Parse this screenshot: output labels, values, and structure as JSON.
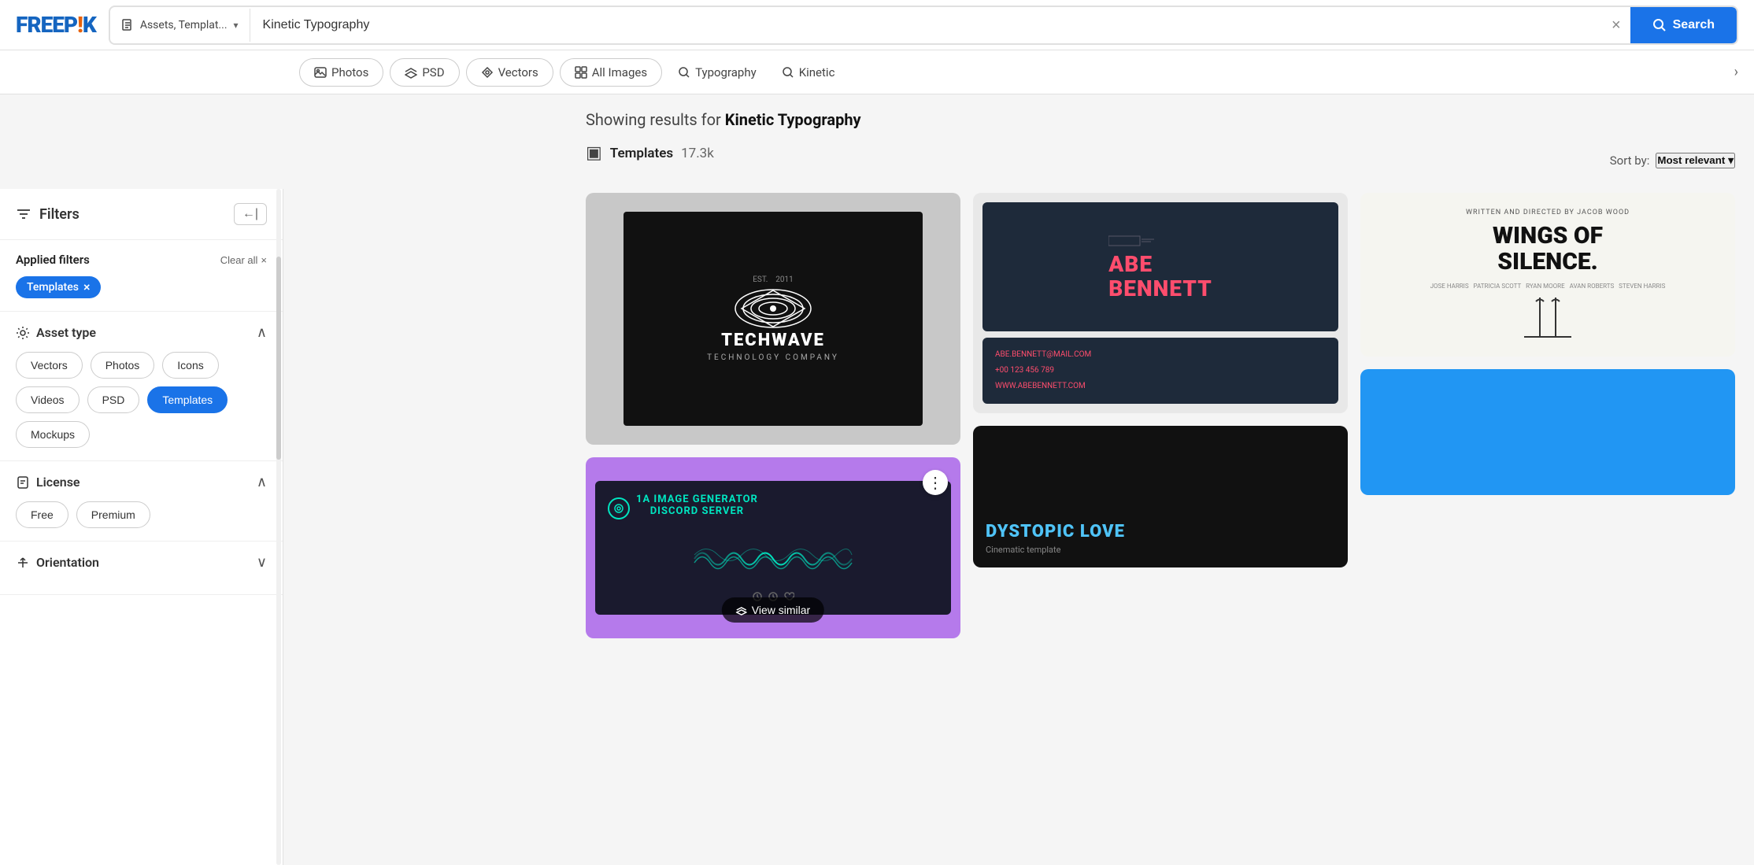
{
  "logo": {
    "text": "FREEPIK",
    "free": "FREEP!K"
  },
  "header": {
    "search_type_label": "Assets, Templat...",
    "search_value": "Kinetic Typography",
    "search_button_label": "Search",
    "clear_title": "Clear search"
  },
  "sub_nav": {
    "items": [
      {
        "id": "photos",
        "label": "Photos",
        "icon": "image"
      },
      {
        "id": "psd",
        "label": "PSD",
        "icon": "layers"
      },
      {
        "id": "vectors",
        "label": "Vectors",
        "icon": "pen-tool"
      },
      {
        "id": "all-images",
        "label": "All Images",
        "icon": "grid"
      },
      {
        "id": "typography",
        "label": "Typography",
        "icon": "search"
      },
      {
        "id": "kinetic",
        "label": "Kinetic",
        "icon": "search"
      }
    ],
    "chevron_right": "›"
  },
  "sidebar": {
    "title": "Filters",
    "collapse_icon": "←|",
    "applied_filters": {
      "label": "Applied filters",
      "clear_label": "Clear all",
      "clear_icon": "×",
      "tags": [
        {
          "id": "templates",
          "label": "Templates",
          "removable": true
        }
      ]
    },
    "sections": [
      {
        "id": "asset-type",
        "title": "Asset type",
        "icon": "⚙",
        "expanded": true,
        "items": [
          {
            "id": "vectors",
            "label": "Vectors",
            "active": false
          },
          {
            "id": "photos",
            "label": "Photos",
            "active": false
          },
          {
            "id": "icons",
            "label": "Icons",
            "active": false
          },
          {
            "id": "videos",
            "label": "Videos",
            "active": false
          },
          {
            "id": "psd",
            "label": "PSD",
            "active": false
          },
          {
            "id": "templates",
            "label": "Templates",
            "active": true
          },
          {
            "id": "mockups",
            "label": "Mockups",
            "active": false
          }
        ]
      },
      {
        "id": "license",
        "title": "License",
        "icon": "🏷",
        "expanded": true,
        "items": [
          {
            "id": "free",
            "label": "Free",
            "active": false
          },
          {
            "id": "premium",
            "label": "Premium",
            "active": false
          }
        ]
      },
      {
        "id": "orientation",
        "title": "Orientation",
        "icon": "↻",
        "expanded": false,
        "items": []
      }
    ]
  },
  "results": {
    "showing_prefix": "Showing results for",
    "query": "Kinetic Typography",
    "category_icon": "▣",
    "category_label": "Templates",
    "category_count": "17.3k",
    "sort_by_label": "Sort by:",
    "sort_by_value": "Most relevant",
    "sort_chevron": "▾",
    "view_similar_label": "View similar",
    "dots_menu": "⋮",
    "cards": [
      {
        "id": "techwave",
        "type": "techwave",
        "bg": "#c8c8c8",
        "title": "TECHWAVE",
        "subtitle": "TECHNOLOGY COMPANY",
        "est": "EST.  2011"
      },
      {
        "id": "discord",
        "type": "discord",
        "bg": "#b57aeb",
        "title": "1A IMAGE GENERATOR DISCORD SERVER",
        "has_dots": true,
        "has_view_similar": true
      },
      {
        "id": "abebennett",
        "type": "abebennett",
        "bg": "#e8e8e8",
        "name": "ABE\nBENNETT",
        "email": "ABE.BENNETT@MAIL.COM",
        "phone": "+00 123 456 789",
        "website": "WWW.ABEBENNETT.COM"
      },
      {
        "id": "dystopic",
        "type": "dystopic",
        "bg": "#1a1a2e",
        "title": "DYSTOPIC LOVE"
      },
      {
        "id": "wings",
        "type": "wings",
        "bg": "#f5f5f0",
        "subtitle": "WRITTEN AND DIRECTED BY JACOB WOOD",
        "title": "WINGS OF SILENCE.",
        "credits": "JOSE HARRIS  PATRICIA SCOTT  RYAN MOORE  AVAN ROBERTS  STEVEN HARRIS"
      },
      {
        "id": "blue-card",
        "type": "blue",
        "bg": "#2196f3"
      }
    ]
  }
}
